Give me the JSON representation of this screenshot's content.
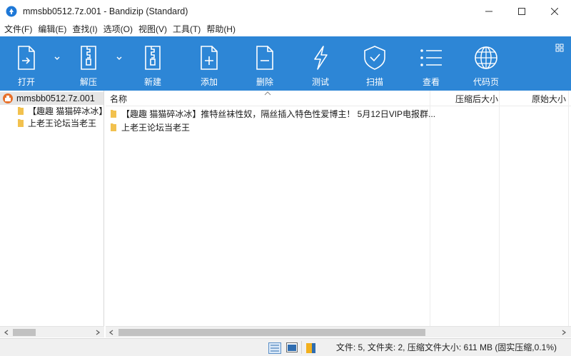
{
  "window": {
    "title": "mmsbb0512.7z.001 - Bandizip (Standard)",
    "icons": [
      "bandizip-app-icon",
      "minimize-icon",
      "maximize-icon",
      "close-icon"
    ]
  },
  "menu": [
    "文件(F)",
    "编辑(E)",
    "查找(I)",
    "选项(O)",
    "视图(V)",
    "工具(T)",
    "帮助(H)"
  ],
  "toolbar": {
    "color": "#2d86d6",
    "buttons": [
      {
        "label": "打开",
        "icon": "open-file-icon"
      },
      {
        "label": "解压",
        "icon": "extract-icon"
      },
      {
        "label": "新建",
        "icon": "new-archive-icon"
      },
      {
        "label": "添加",
        "icon": "add-file-icon"
      },
      {
        "label": "删除",
        "icon": "delete-file-icon"
      },
      {
        "label": "测试",
        "icon": "test-lightning-icon"
      },
      {
        "label": "扫描",
        "icon": "scan-shield-icon"
      },
      {
        "label": "查看",
        "icon": "view-list-icon"
      },
      {
        "label": "代码页",
        "icon": "codepage-globe-icon"
      }
    ]
  },
  "tree": {
    "root": "mmsbb0512.7z.001",
    "children": [
      "【趣趣 猫猫碎冰冰】",
      "上老王论坛当老王"
    ]
  },
  "list": {
    "columns": {
      "name": "名称",
      "packed": "压缩后大小",
      "original": "原始大小"
    },
    "rows": [
      {
        "name": "【趣趣 猫猫碎冰冰】推特丝袜性奴，隔丝插入特色性爱博主！ 5月12日VIP电报群..."
      },
      {
        "name": "上老王论坛当老王"
      }
    ]
  },
  "status": {
    "text": "文件: 5, 文件夹: 2, 压缩文件大小: 611 MB (固实压缩,0.1%)"
  }
}
